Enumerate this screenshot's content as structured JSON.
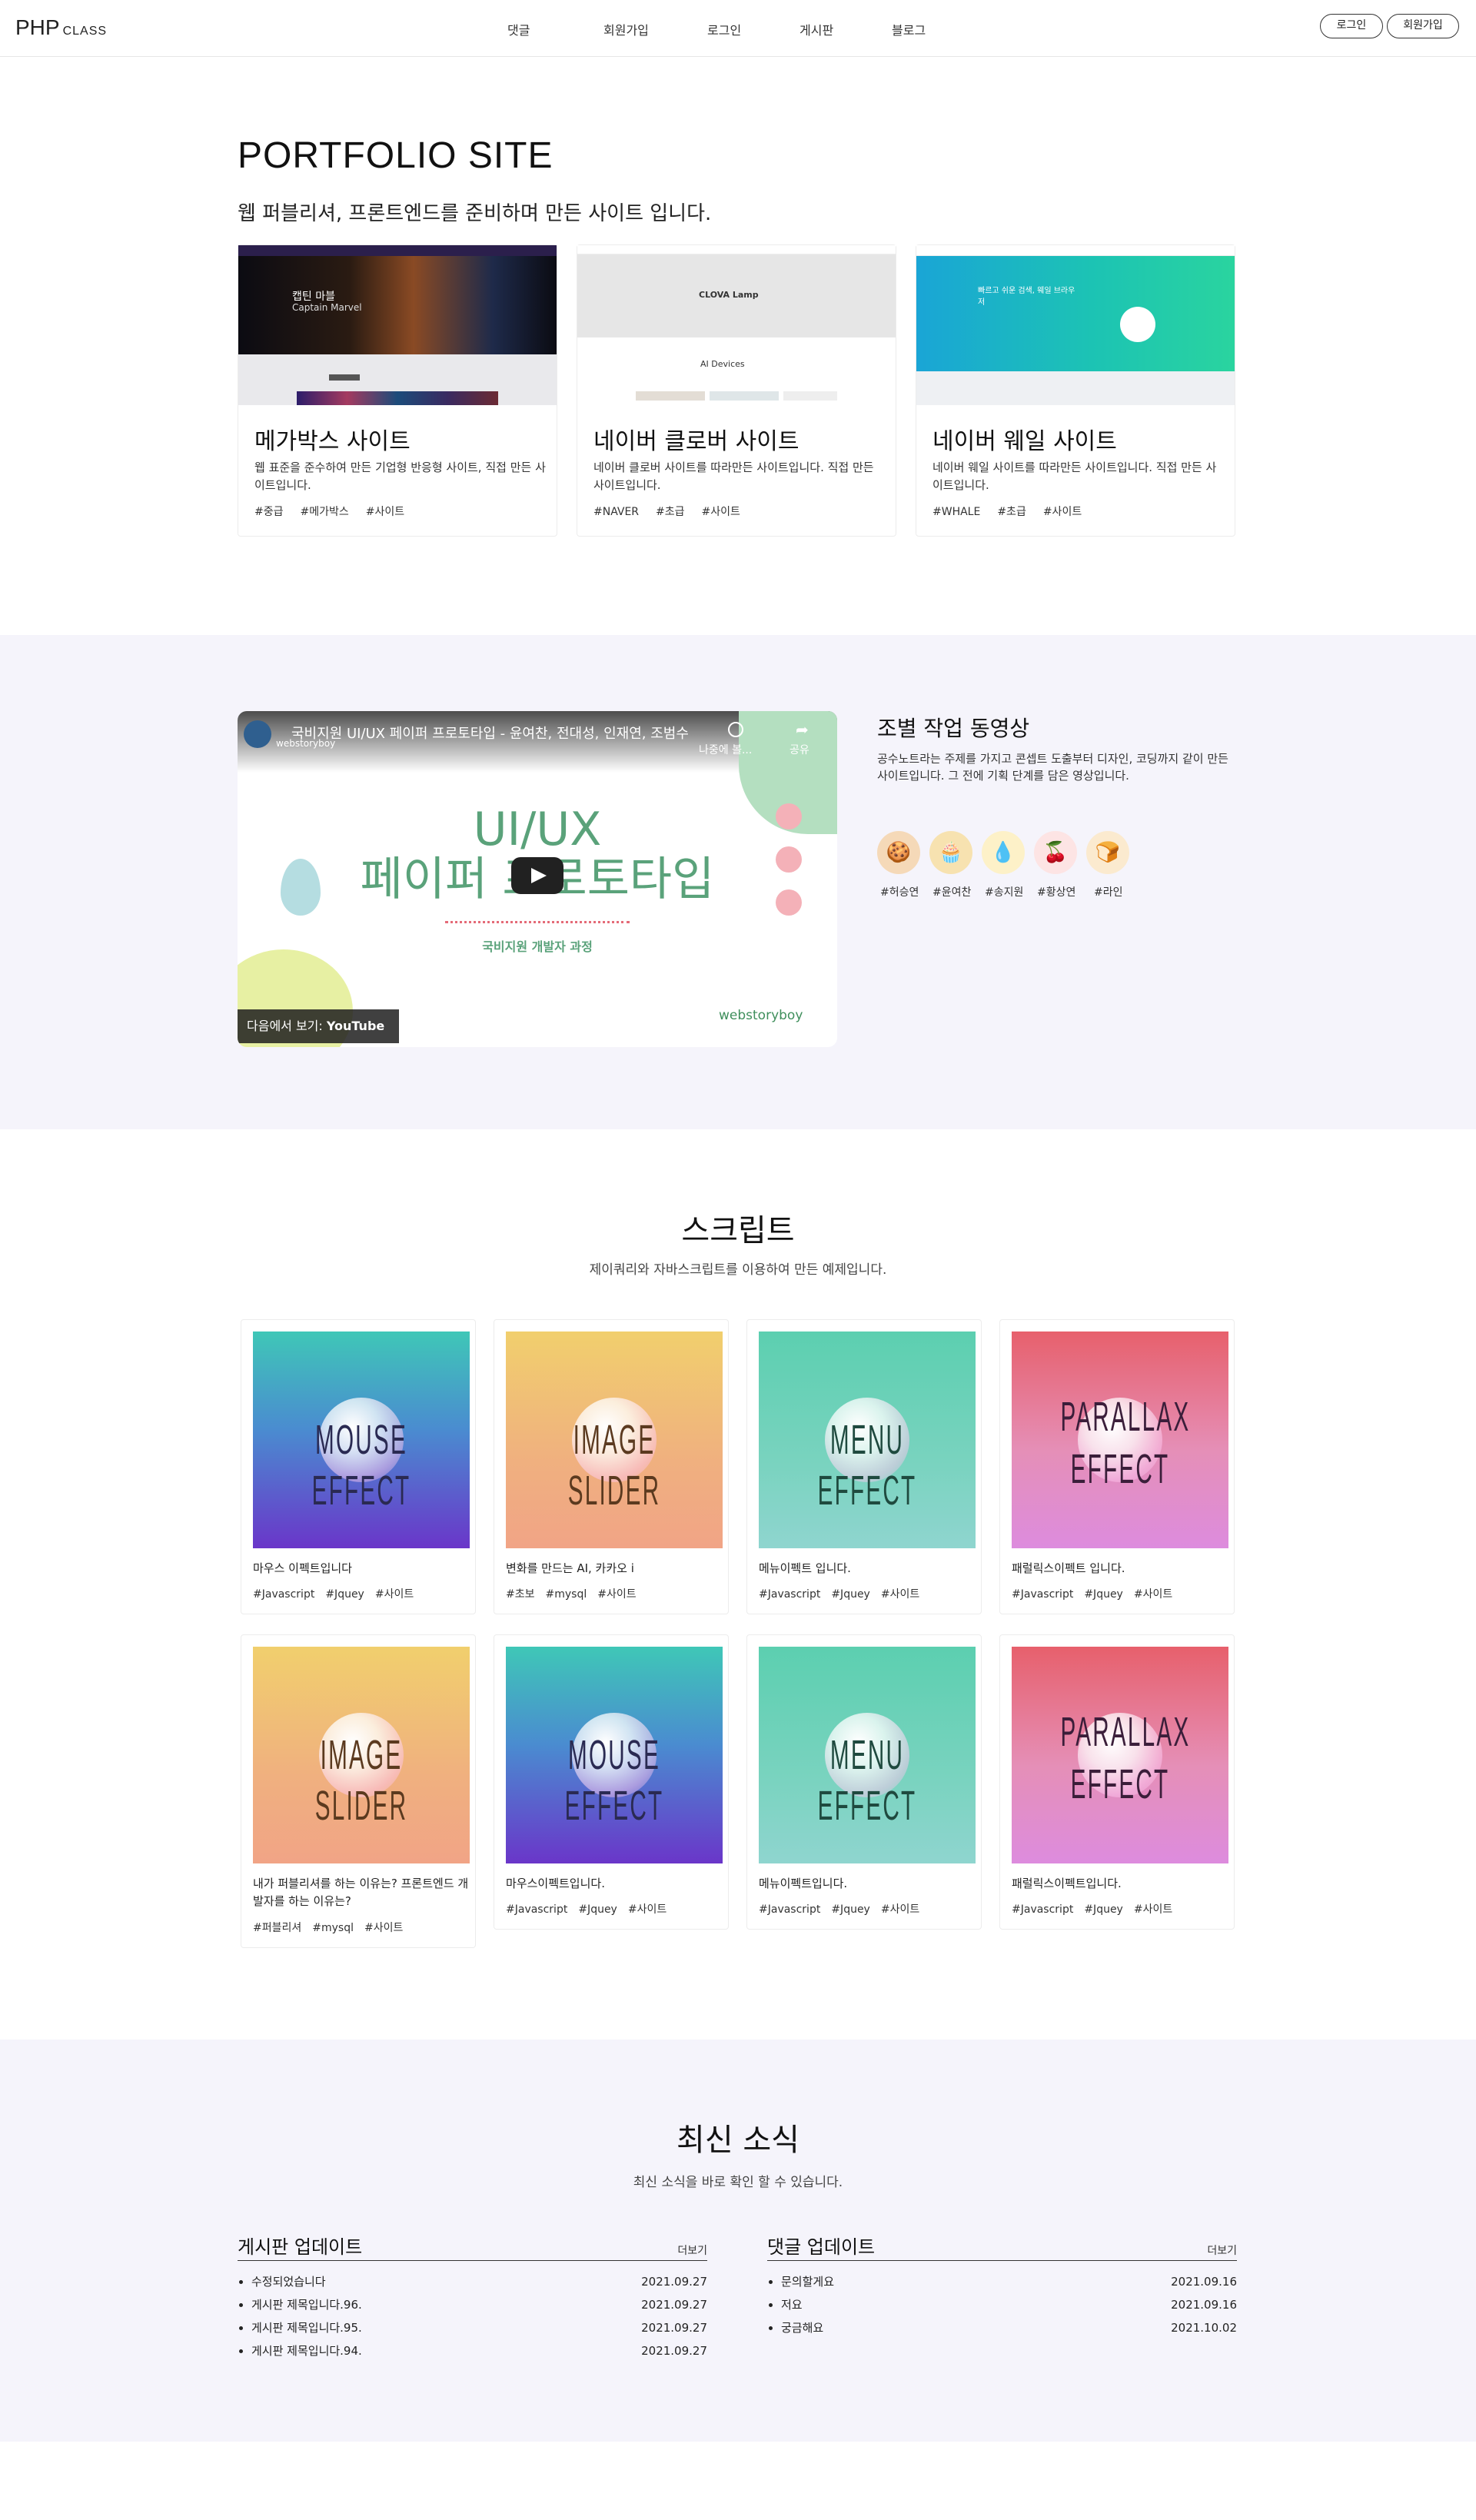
{
  "header": {
    "logo_main": "PHP",
    "logo_sub": "CLASS",
    "nav": [
      "댓글",
      "회원가입",
      "로그인",
      "게시판",
      "블로그"
    ],
    "login_btn": "로그인",
    "join_btn": "회원가입"
  },
  "portfolio": {
    "title": "PORTFOLIO SITE",
    "subtitle": "웹 퍼블리셔, 프론트엔드를 준비하며 만든 사이트 입니다.",
    "cards": [
      {
        "title": "메가박스 사이트",
        "desc": "웹 표준을 준수하여 만든 기업형 반응형 사이트, 직접 만든 사이트입니다.",
        "tags": [
          "#중급",
          "#메가박스",
          "#사이트"
        ],
        "shot_text": [
          "캡틴 마블",
          "Captain Marvel"
        ]
      },
      {
        "title": "네이버 클로버 사이트",
        "desc": "네이버 클로버 사이트를 따라만든 사이트입니다. 직접 만든 사이트입니다.",
        "tags": [
          "#NAVER",
          "#초급",
          "#사이트"
        ],
        "shot_text": [
          "CLOVA Lamp",
          "AI Devices"
        ]
      },
      {
        "title": "네이버 웨일 사이트",
        "desc": "네이버 웨일 사이트를 따라만든 사이트입니다. 직접 만든 사이트입니다.",
        "tags": [
          "#WHALE",
          "#초급",
          "#사이트"
        ],
        "shot_text": [
          "빠르고 쉬운 검색, 웨일 브라우저"
        ]
      }
    ]
  },
  "video": {
    "player_title": "국비지원 UI/UX 페이퍼 프로토타입 - 윤여찬, 전대성, 인재연, 조범수",
    "channel": "webstoryboy",
    "watch_later": "나중에 볼...",
    "share": "공유",
    "heading_1": "UI/UX",
    "heading_2": "페이퍼 프로토타입",
    "caption": "국비지원 개발자 과정",
    "brand": "webstoryboy",
    "watch_on": "다음에서 보기:",
    "yt": "YouTube",
    "info_title": "조별 작업 동영상",
    "info_desc": "공수노트라는 주제를 가지고 콘셉트 도출부터 디자인, 코딩까지 같이 만든 사이트입니다. 그 전에 기획 단계를 담은 영상입니다.",
    "members": [
      {
        "name": "#허승연",
        "icon": "cookie-icon",
        "glyph": "🍪",
        "bg": "#f5d9b8"
      },
      {
        "name": "#윤여찬",
        "icon": "cupcake-icon",
        "glyph": "🧁",
        "bg": "#f7e2b0"
      },
      {
        "name": "#송지원",
        "icon": "drop-icon",
        "glyph": "💧",
        "bg": "#fdf1c8"
      },
      {
        "name": "#황상연",
        "icon": "cherry-icon",
        "glyph": "🍒",
        "bg": "#fde4e4"
      },
      {
        "name": "#라인",
        "icon": "toast-icon",
        "glyph": "🍞",
        "bg": "#fbeacf"
      }
    ]
  },
  "script": {
    "title": "스크립트",
    "subtitle": "제이쿼리와 자바스크립트를 이용하여 만든 예제입니다.",
    "cards": [
      {
        "thumb": [
          "MOUSE",
          "EFFECT"
        ],
        "theme": "mouse",
        "desc": "마우스 이펙트입니다",
        "tags": [
          "#Javascript",
          "#Jquey",
          "#사이트"
        ]
      },
      {
        "thumb": [
          "IMAGE",
          "SLIDER"
        ],
        "theme": "image",
        "desc": "변화를 만드는 AI, 카카오 i",
        "tags": [
          "#초보",
          "#mysql",
          "#사이트"
        ]
      },
      {
        "thumb": [
          "MENU",
          "EFFECT"
        ],
        "theme": "menu",
        "desc": "메뉴이펙트 입니다.",
        "tags": [
          "#Javascript",
          "#Jquey",
          "#사이트"
        ]
      },
      {
        "thumb": [
          "PARALLAX",
          "EFFECT"
        ],
        "theme": "parallax",
        "desc": "패럴릭스이펙트 입니다.",
        "tags": [
          "#Javascript",
          "#Jquey",
          "#사이트"
        ]
      },
      {
        "thumb": [
          "IMAGE",
          "SLIDER"
        ],
        "theme": "image",
        "desc": "내가 퍼블리셔를 하는 이유는? 프론트엔드 개발자를 하는 이유는?",
        "tags": [
          "#퍼블리셔",
          "#mysql",
          "#사이트"
        ]
      },
      {
        "thumb": [
          "MOUSE",
          "EFFECT"
        ],
        "theme": "mouse",
        "desc": "마우스이펙트입니다.",
        "tags": [
          "#Javascript",
          "#Jquey",
          "#사이트"
        ]
      },
      {
        "thumb": [
          "MENU",
          "EFFECT"
        ],
        "theme": "menu",
        "desc": "메뉴이펙트입니다.",
        "tags": [
          "#Javascript",
          "#Jquey",
          "#사이트"
        ]
      },
      {
        "thumb": [
          "PARALLAX",
          "EFFECT"
        ],
        "theme": "parallax",
        "desc": "패럴릭스이펙트입니다.",
        "tags": [
          "#Javascript",
          "#Jquey",
          "#사이트"
        ]
      }
    ]
  },
  "news": {
    "title": "최신 소식",
    "subtitle": "최신 소식을 바로 확인 할 수 있습니다.",
    "board": {
      "title": "게시판 업데이트",
      "more": "더보기",
      "items": [
        {
          "text": "수정되었습니다",
          "date": "2021.09.27"
        },
        {
          "text": "게시판 제목입니다.96.",
          "date": "2021.09.27"
        },
        {
          "text": "게시판 제목입니다.95.",
          "date": "2021.09.27"
        },
        {
          "text": "게시판 제목입니다.94.",
          "date": "2021.09.27"
        }
      ]
    },
    "comment": {
      "title": "댓글 업데이트",
      "more": "더보기",
      "items": [
        {
          "text": "문의할게요",
          "date": "2021.09.16"
        },
        {
          "text": "저요",
          "date": "2021.09.16"
        },
        {
          "text": "궁금해요",
          "date": "2021.10.02"
        }
      ]
    }
  }
}
